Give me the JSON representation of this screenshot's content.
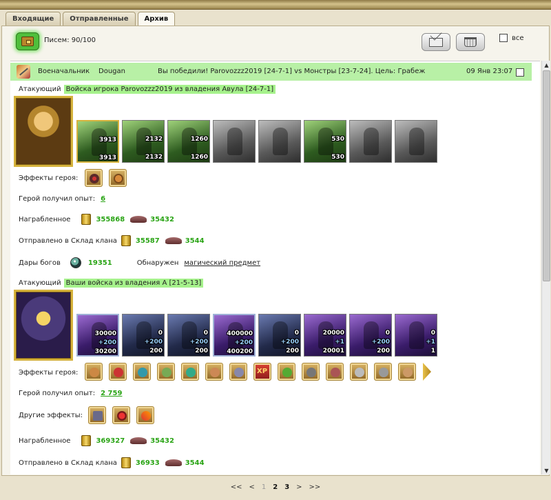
{
  "tabs": [
    "Входящие",
    "Отправленные",
    "Архив"
  ],
  "active_tab": "Архив",
  "toolbar": {
    "letters_label": "Писем: 90/100",
    "select_all_label": "все"
  },
  "message": {
    "type": "Военачальник",
    "from": "Dougan",
    "subject": "Вы победили! Parovozzz2019 [24-7-1] vs Монстры [23-7-24]. Цель: Грабеж",
    "date": "09 Янв 23:07"
  },
  "attacker1": {
    "label": "Атакующий",
    "title": "Войска игрока Parovozzz2019 из владения Авула [24-7-1]",
    "units": [
      {
        "top": "3913",
        "mid": "",
        "bottom": "3913",
        "style": "green",
        "frame": "gold"
      },
      {
        "top": "2132",
        "mid": "",
        "bottom": "2132",
        "style": "green",
        "frame": ""
      },
      {
        "top": "1260",
        "mid": "",
        "bottom": "1260",
        "style": "green",
        "frame": ""
      },
      {
        "top": "",
        "mid": "",
        "bottom": "",
        "style": "gray",
        "frame": ""
      },
      {
        "top": "",
        "mid": "",
        "bottom": "",
        "style": "gray",
        "frame": ""
      },
      {
        "top": "530",
        "mid": "",
        "bottom": "530",
        "style": "green",
        "frame": ""
      },
      {
        "top": "",
        "mid": "",
        "bottom": "",
        "style": "gray",
        "frame": ""
      },
      {
        "top": "",
        "mid": "",
        "bottom": "",
        "style": "gray",
        "frame": ""
      }
    ],
    "hero_effects_label": "Эффекты героя:",
    "exp_label": "Герой получил опыт:",
    "exp_value": "6",
    "reward_label": "Награбленное",
    "reward_gold": "355868",
    "reward_ore": "35432",
    "clan_label": "Отправлено в Склад клана",
    "clan_gold": "35587",
    "clan_ore": "3544",
    "gifts_label": "Дары богов",
    "gifts_value": "19351",
    "found_label": "Обнаружен",
    "found_item": "магический предмет"
  },
  "attacker2": {
    "label": "Атакующий",
    "title": "Ваши войска из владения А [21-5-13]",
    "units": [
      {
        "top": "30000",
        "mid": "+200",
        "bottom": "30200",
        "style": "purple",
        "frame": "blue"
      },
      {
        "top": "0",
        "mid": "+200",
        "bottom": "200",
        "style": "night",
        "frame": ""
      },
      {
        "top": "0",
        "mid": "+200",
        "bottom": "200",
        "style": "night",
        "frame": ""
      },
      {
        "top": "400000",
        "mid": "+200",
        "bottom": "400200",
        "style": "purple",
        "frame": "blue"
      },
      {
        "top": "0",
        "mid": "+200",
        "bottom": "200",
        "style": "night",
        "frame": ""
      },
      {
        "top": "20000",
        "mid": "+1",
        "bottom": "20001",
        "style": "purple",
        "frame": ""
      },
      {
        "top": "0",
        "mid": "+200",
        "bottom": "200",
        "style": "purple",
        "frame": ""
      },
      {
        "top": "0",
        "mid": "+1",
        "bottom": "1",
        "style": "purple",
        "frame": ""
      }
    ],
    "hero_effects_label": "Эффекты героя:",
    "exp_label": "Герой получил опыт:",
    "exp_value": "2 759",
    "other_effects_label": "Другие эффекты:",
    "reward_label": "Награбленное",
    "reward_gold": "369327",
    "reward_ore": "35432",
    "clan_label": "Отправлено в Склад клана",
    "clan_gold": "36933",
    "clan_ore": "3544"
  },
  "hero_effects_2_icons": [
    "gift-box",
    "dice",
    "shield",
    "hand-shield",
    "sword",
    "handshake",
    "banner",
    "xp",
    "xp-potion",
    "wolf",
    "claw",
    "armor",
    "ring",
    "scroll"
  ],
  "xp_text": "XP",
  "pager": {
    "first": "<<",
    "prev": "<",
    "pages": [
      "1",
      "2",
      "3"
    ],
    "next": ">",
    "last": ">>"
  },
  "colors": {
    "header_green": "#b8f0a6",
    "highlight_green": "#a6f28c",
    "value_green": "#2aa415"
  }
}
